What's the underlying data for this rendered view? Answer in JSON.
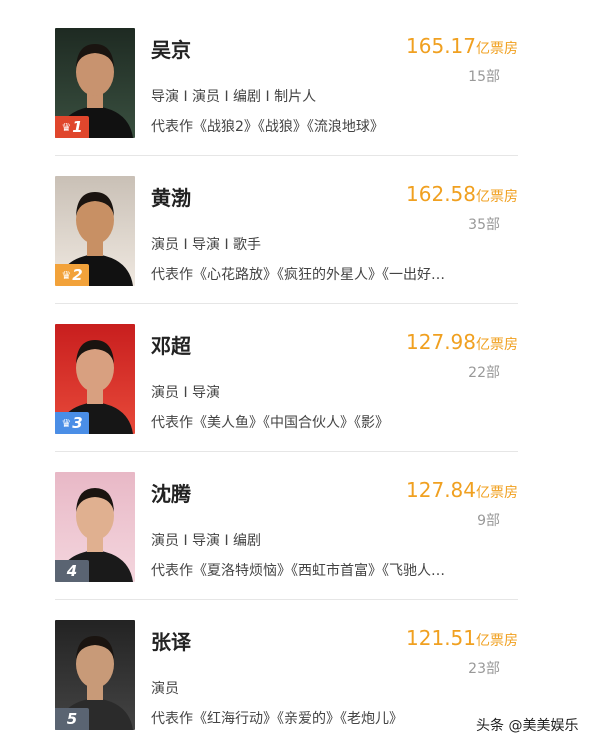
{
  "gross_unit": "亿票房",
  "count_unit": "部",
  "works_prefix": "代表作",
  "actors": [
    {
      "rank": "1",
      "name": "吴京",
      "gross": "165.17",
      "count": "15部",
      "roles": "导演 I 演员 I 编剧 I 制片人",
      "works": "代表作《战狼2》《战狼》《流浪地球》",
      "badge_color": "#e0462c",
      "crown": true
    },
    {
      "rank": "2",
      "name": "黄渤",
      "gross": "162.58",
      "count": "35部",
      "roles": "演员 I 导演 I 歌手",
      "works": "代表作《心花路放》《疯狂的外星人》《一出好…",
      "badge_color": "#f2a23a",
      "crown": true
    },
    {
      "rank": "3",
      "name": "邓超",
      "gross": "127.98",
      "count": "22部",
      "roles": "演员 I 导演",
      "works": "代表作《美人鱼》《中国合伙人》《影》",
      "badge_color": "#4a8ee6",
      "crown": true
    },
    {
      "rank": "4",
      "name": "沈腾",
      "gross": "127.84",
      "count": "9部",
      "roles": "演员 I 导演 I 编剧",
      "works": "代表作《夏洛特烦恼》《西虹市首富》《飞驰人…",
      "badge_color": "#5a6472",
      "crown": false
    },
    {
      "rank": "5",
      "name": "张译",
      "gross": "121.51",
      "count": "23部",
      "roles": "演员",
      "works": "代表作《红海行动》《亲爱的》《老炮儿》",
      "badge_color": "#5a6472",
      "crown": false
    }
  ],
  "watermark": "头条 @美美娱乐"
}
